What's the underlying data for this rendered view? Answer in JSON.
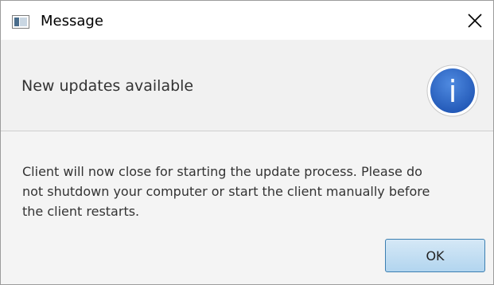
{
  "window": {
    "title": "Message",
    "app_icon": "window-app-icon",
    "close_icon": "close-icon"
  },
  "header": {
    "text": "New updates available",
    "icon": "info-icon",
    "icon_glyph": "i",
    "icon_color": "#2c68c8"
  },
  "content": {
    "message_lines": [
      "Client will now close for starting the update process. Please do",
      "not shutdown your computer or start the client manually before",
      "the client restarts."
    ]
  },
  "buttons": {
    "ok_label": "OK"
  },
  "colors": {
    "header_bg": "#f1f1f1",
    "content_bg": "#f4f4f4",
    "button_border": "#3c7fb1"
  }
}
